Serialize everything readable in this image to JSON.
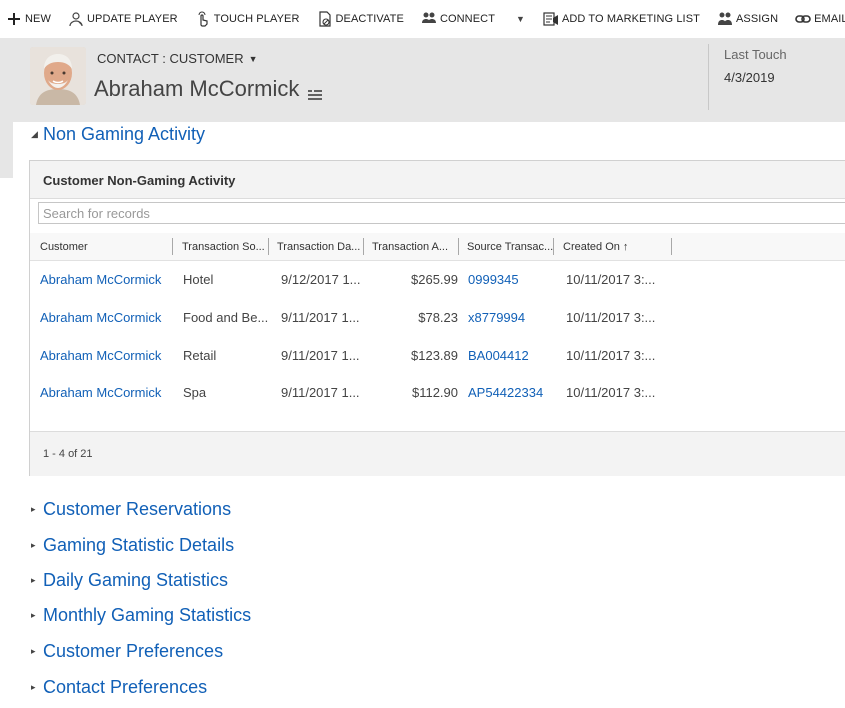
{
  "commands": [
    {
      "label": "NEW",
      "icon": "plus-icon"
    },
    {
      "label": "UPDATE PLAYER",
      "icon": "update-player-icon"
    },
    {
      "label": "TOUCH PLAYER",
      "icon": "hand-touch-icon"
    },
    {
      "label": "DEACTIVATE",
      "icon": "deactivate-icon"
    },
    {
      "label": "CONNECT",
      "icon": "connect-people-icon"
    },
    {
      "label": "ADD TO MARKETING LIST",
      "icon": "marketing-list-icon"
    },
    {
      "label": "ASSIGN",
      "icon": "assign-icon"
    },
    {
      "label": "EMAIL A LINK",
      "icon": "link-icon"
    }
  ],
  "header": {
    "entity_type": "CONTACT : CUSTOMER",
    "record_name": "Abraham McCormick",
    "last_touch_label": "Last Touch",
    "last_touch_value": "4/3/2019"
  },
  "sections": {
    "non_gaming": "Non Gaming Activity",
    "collapsed": [
      "Customer Reservations",
      "Gaming Statistic Details",
      "Daily Gaming Statistics",
      "Monthly Gaming Statistics",
      "Customer Preferences",
      "Contact Preferences"
    ]
  },
  "subgrid": {
    "title": "Customer Non-Gaming Activity",
    "search_placeholder": "Search for records",
    "columns": [
      "Customer",
      "Transaction So...",
      "Transaction Da...",
      "Transaction A...",
      "Source Transac...",
      "Created On ↑"
    ],
    "rows": [
      {
        "customer": "Abraham McCormick",
        "source": "Hotel",
        "date": "9/12/2017 1...",
        "amount": "$265.99",
        "source_txn": "0999345",
        "created": "10/11/2017 3:..."
      },
      {
        "customer": "Abraham McCormick",
        "source": "Food and Be...",
        "date": "9/11/2017 1...",
        "amount": "$78.23",
        "source_txn": "x8779994",
        "created": "10/11/2017 3:..."
      },
      {
        "customer": "Abraham McCormick",
        "source": "Retail",
        "date": "9/11/2017 1...",
        "amount": "$123.89",
        "source_txn": "BA004412",
        "created": "10/11/2017 3:..."
      },
      {
        "customer": "Abraham McCormick",
        "source": "Spa",
        "date": "9/11/2017 1...",
        "amount": "$112.90",
        "source_txn": "AP54422334",
        "created": "10/11/2017 3:..."
      }
    ],
    "count": "1 - 4 of 21"
  }
}
